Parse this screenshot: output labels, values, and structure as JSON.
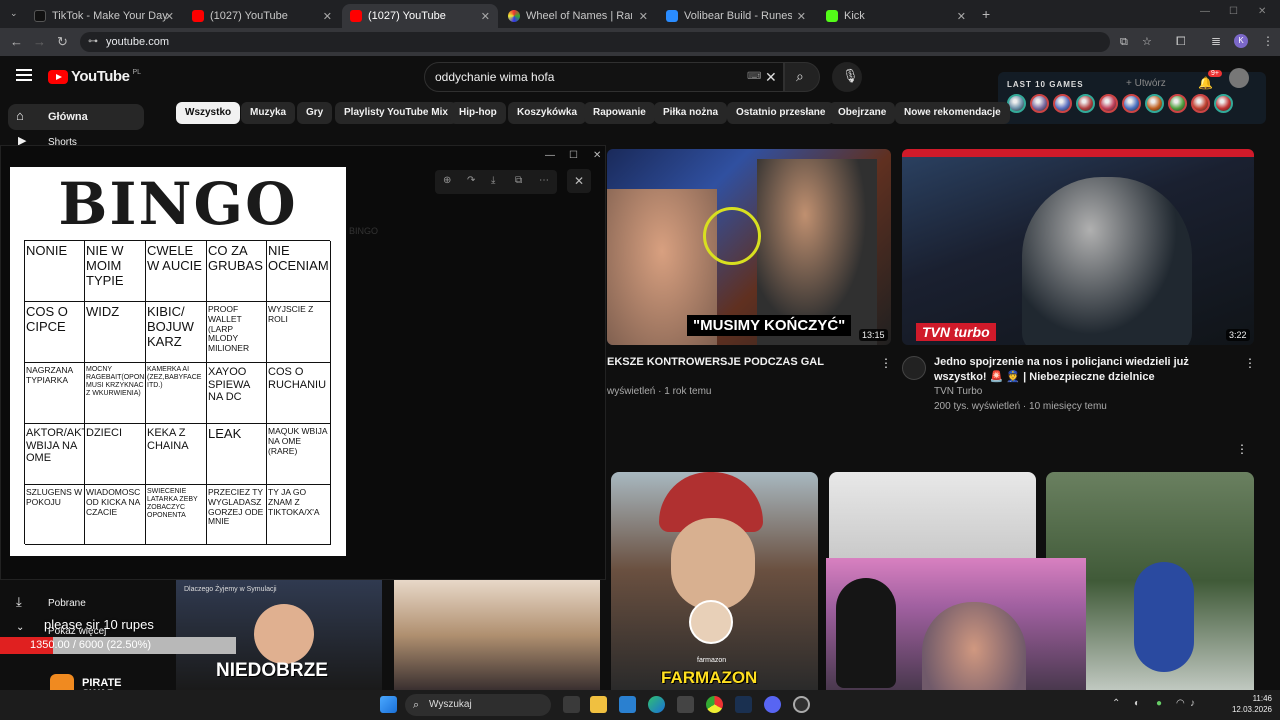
{
  "browser": {
    "tabs": [
      {
        "title": "TikTok - Make Your Day",
        "color": "#111111"
      },
      {
        "title": "(1027) YouTube",
        "color": "#ff0000"
      },
      {
        "title": "(1027) YouTube",
        "color": "#ff0000",
        "active": true
      },
      {
        "title": "Wheel of Names | Random nam",
        "color": "#3a7bd5"
      },
      {
        "title": "Volibear Build - Runes & Items",
        "color": "#2a8cff"
      },
      {
        "title": "Kick",
        "color": "#53fc18"
      }
    ],
    "new_tab": "+",
    "url": "youtube.com",
    "profile_initial": "K"
  },
  "youtube": {
    "logo_text": "YouTube",
    "region": "PL",
    "search_value": "oddychanie wima hofa",
    "create_label": "Utwórz",
    "notifications": "9+",
    "sidebar": {
      "home": "Główna",
      "shorts": "Shorts",
      "downloads": "Pobrane",
      "more": "Pokaż więcej"
    },
    "chips": [
      "Wszystko",
      "Muzyka",
      "Gry",
      "Playlisty YouTube Mix",
      "Hip-hop",
      "Koszykówka",
      "Rapowanie",
      "Piłka nożna",
      "Ostatnio przesłane",
      "Obejrzane",
      "Nowe rekomendacje"
    ],
    "videos": [
      {
        "title": "EKSZE KONTROWERSJE PODCZAS GAL",
        "meta": "wyświetleń · 1 rok temu",
        "caption": "\"MUSIMY KOŃCZYĆ\"",
        "duration": "13:15"
      },
      {
        "title": "Jedno spojrzenie na nos i policjanci wiedzieli już wszystko! 🚨 👮 | Niebezpieczne dzielnice",
        "channel": "TVN Turbo",
        "meta": "200 tys. wyświetleń · 10 miesięcy temu",
        "brand": "TVN turbo",
        "duration": "3:22"
      }
    ],
    "shorts_captions": [
      "NIEDOBRZE",
      "FARMAZON"
    ],
    "shorts_labels": [
      "Dlaczego Żyjemy w Symulacji",
      "farmazon"
    ]
  },
  "last_games": {
    "title": "LAST 10 GAMES",
    "colors": [
      "#6a8fa8",
      "#7a6aa0",
      "#5a6ec0",
      "#b04040",
      "#c0405a",
      "#4a70c0",
      "#c06020",
      "#50a040",
      "#c04030",
      "#c03030"
    ]
  },
  "viewer": {
    "window_controls": [
      "—",
      "☐",
      "✕"
    ],
    "close": "✕",
    "faded_title": "BINGO"
  },
  "bingo": {
    "title": "BINGO",
    "cells": [
      [
        "NONIE",
        "NIE W MOIM TYPIE",
        "CWELE W AUCIE",
        "CO ZA GRUBAS",
        "NIE OCENIAM"
      ],
      [
        "COS O CIPCE",
        "WIDZ",
        "KIBIC/ BOJUW KARZ",
        "PROOF WALLET (LARP MLODY MILIONER",
        "WYJSCIE Z ROLI"
      ],
      [
        "NAGRZANA TYPIARKA",
        "MOCNY RAGEBAIT(OPONENT MUSI KRZYKNAC Z WKURWIENIA)",
        "KAMERKA AI (ZEZ,BABYFACE ITD.)",
        "XAYOO SPIEWA NA DC",
        "COS O RUCHANIU"
      ],
      [
        "AKTOR/AKTORKA WBIJA NA OME",
        "DZIECI",
        "KEKA Z CHAINA",
        "LEAK",
        "MAQUK WBIJA NA OME (RARE)"
      ],
      [
        "SZLUGENS W POKOJU",
        "WIADOMOSC OD KICKA NA CZACIE",
        "SWIECENIE LATARKA ZEBY ZOBACZYC OPONENTA",
        "PRZECIEZ TY WYGLADASZ GORZEJ ODE MNIE",
        "TY JA GO ZNAM Z TIKTOKA/X'A"
      ]
    ]
  },
  "stream": {
    "donation_text": "please sir 10 rupes",
    "donation_progress": "1350.00 / 6000 (22.50%)",
    "donation_fraction": 0.225,
    "sponsor": "PIRATE SWAP"
  },
  "taskbar": {
    "search_label": "Wyszukaj",
    "time": "11:46",
    "date": "12.03.2026"
  }
}
